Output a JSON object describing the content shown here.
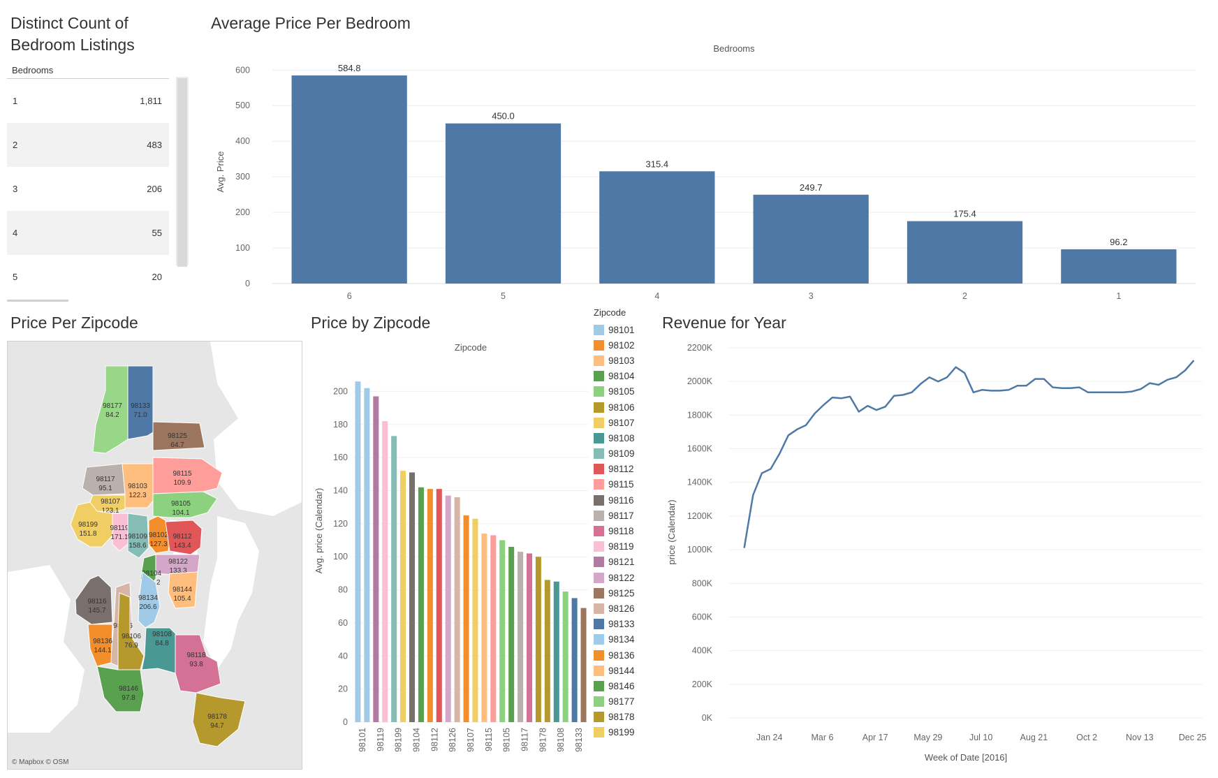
{
  "titles": {
    "distinct": "Distinct Count of Bedroom Listings",
    "avg_price": "Average Price Per Bedroom",
    "price_zip": "Price Per Zipcode",
    "price_by_zip": "Price by Zipcode",
    "revenue": "Revenue for Year"
  },
  "table": {
    "header": "Bedrooms",
    "rows": [
      {
        "bedrooms": "1",
        "count": "1,811"
      },
      {
        "bedrooms": "2",
        "count": "483"
      },
      {
        "bedrooms": "3",
        "count": "206"
      },
      {
        "bedrooms": "4",
        "count": "55"
      },
      {
        "bedrooms": "5",
        "count": "20"
      }
    ]
  },
  "map": {
    "attribution": "© Mapbox © OSM",
    "colors": {
      "water": "#ffffff",
      "land": "#e6e6e6"
    },
    "regions": [
      {
        "zip": "98177",
        "value": "84.2",
        "color": "#98d688"
      },
      {
        "zip": "98133",
        "value": "71.0",
        "color": "#4e79a7"
      },
      {
        "zip": "98125",
        "value": "64.7",
        "color": "#9c755f"
      },
      {
        "zip": "98117",
        "value": "95.1",
        "color": "#bab0ac"
      },
      {
        "zip": "98103",
        "value": "122.3",
        "color": "#ffbe7d"
      },
      {
        "zip": "98115",
        "value": "109.9",
        "color": "#ff9d9a"
      },
      {
        "zip": "98107",
        "value": "123.1",
        "color": "#f1ce63"
      },
      {
        "zip": "98105",
        "value": "104.1",
        "color": "#8cd17d"
      },
      {
        "zip": "98199",
        "value": "151.8",
        "color": "#f1ce63"
      },
      {
        "zip": "98119",
        "value": "171.1",
        "color": "#fabfd2"
      },
      {
        "zip": "98109",
        "value": "158.6",
        "color": "#86bcb6"
      },
      {
        "zip": "98102",
        "value": "127.3",
        "color": "#f28e2b"
      },
      {
        "zip": "98112",
        "value": "143.4",
        "color": "#e15759"
      },
      {
        "zip": "98122",
        "value": "133.3",
        "color": "#d4a6c8"
      },
      {
        "zip": "98104",
        "value": "136.2",
        "color": "#59a14f"
      },
      {
        "zip": "98144",
        "value": "105.4",
        "color": "#ffbe7d"
      },
      {
        "zip": "98116",
        "value": "145.7",
        "color": "#79706e"
      },
      {
        "zip": "98134",
        "value": "206.6",
        "color": "#a0cbe8"
      },
      {
        "zip": "98126",
        "value": "",
        "color": "#d7b5a6"
      },
      {
        "zip": "98136",
        "value": "144.1",
        "color": "#f28e2b"
      },
      {
        "zip": "98106",
        "value": "76.9",
        "color": "#b6992d"
      },
      {
        "zip": "98108",
        "value": "84.8",
        "color": "#499894"
      },
      {
        "zip": "98118",
        "value": "93.8",
        "color": "#d37295"
      },
      {
        "zip": "98146",
        "value": "97.8",
        "color": "#59a14f"
      },
      {
        "zip": "98178",
        "value": "94.7",
        "color": "#b6992d"
      }
    ]
  },
  "legend": {
    "title": "Zipcode",
    "items": [
      {
        "zip": "98101",
        "color": "#a0cbe8"
      },
      {
        "zip": "98102",
        "color": "#f28e2b"
      },
      {
        "zip": "98103",
        "color": "#ffbe7d"
      },
      {
        "zip": "98104",
        "color": "#59a14f"
      },
      {
        "zip": "98105",
        "color": "#8cd17d"
      },
      {
        "zip": "98106",
        "color": "#b6992d"
      },
      {
        "zip": "98107",
        "color": "#f1ce63"
      },
      {
        "zip": "98108",
        "color": "#499894"
      },
      {
        "zip": "98109",
        "color": "#86bcb6"
      },
      {
        "zip": "98112",
        "color": "#e15759"
      },
      {
        "zip": "98115",
        "color": "#ff9d9a"
      },
      {
        "zip": "98116",
        "color": "#79706e"
      },
      {
        "zip": "98117",
        "color": "#bab0ac"
      },
      {
        "zip": "98118",
        "color": "#d37295"
      },
      {
        "zip": "98119",
        "color": "#fabfd2"
      },
      {
        "zip": "98121",
        "color": "#b07aa1"
      },
      {
        "zip": "98122",
        "color": "#d4a6c8"
      },
      {
        "zip": "98125",
        "color": "#9d7660"
      },
      {
        "zip": "98126",
        "color": "#d7b5a6"
      },
      {
        "zip": "98133",
        "color": "#4e79a7"
      },
      {
        "zip": "98134",
        "color": "#a0cbe8"
      },
      {
        "zip": "98136",
        "color": "#f28e2b"
      },
      {
        "zip": "98144",
        "color": "#ffbe7d"
      },
      {
        "zip": "98146",
        "color": "#59a14f"
      },
      {
        "zip": "98177",
        "color": "#8cd17d"
      },
      {
        "zip": "98178",
        "color": "#b6992d"
      },
      {
        "zip": "98199",
        "color": "#f1ce63"
      }
    ]
  },
  "chart_data": [
    {
      "type": "bar",
      "title": "Average Price Per Bedroom",
      "column_header": "Bedrooms",
      "ylabel": "Avg. Price",
      "categories": [
        "6",
        "5",
        "4",
        "3",
        "2",
        "1"
      ],
      "values": [
        584.8,
        450.0,
        315.4,
        249.7,
        175.4,
        96.2
      ],
      "data_labels": [
        "584.8",
        "450.0",
        "315.4",
        "249.7",
        "175.4",
        "96.2"
      ],
      "yticks": [
        0,
        100,
        200,
        300,
        400,
        500,
        600
      ],
      "ylim": [
        0,
        630
      ],
      "color": "#4e79a7",
      "grid": true
    },
    {
      "type": "bar",
      "title": "Price by Zipcode",
      "column_header": "Zipcode",
      "ylabel": "Avg. price (Calendar)",
      "categories": [
        "98101",
        "98121",
        "98119",
        "98109",
        "98199",
        "98116",
        "98104",
        "98102",
        "98112",
        "98122",
        "98126",
        "98136",
        "98107",
        "98144",
        "98115",
        "98105",
        "98146",
        "98117",
        "98118",
        "98178",
        "98106",
        "98108",
        "98177",
        "98133",
        "98125"
      ],
      "x_tick_labels": [
        "98101",
        "98119",
        "98199",
        "98104",
        "98112",
        "98126",
        "98107",
        "98115",
        "98105",
        "98117",
        "98178",
        "98108",
        "98133"
      ],
      "values": [
        206,
        202,
        197,
        182,
        173,
        152,
        151,
        142,
        141,
        141,
        137,
        136,
        125,
        123,
        114,
        113,
        110,
        106,
        103,
        102,
        100,
        86,
        85,
        79,
        75,
        69
      ],
      "colors": [
        "#a0cbe8",
        "#a0cbe8",
        "#b07aa1",
        "#fabfd2",
        "#86bcb6",
        "#f1ce63",
        "#79706e",
        "#59a14f",
        "#f28e2b",
        "#e15759",
        "#d4a6c8",
        "#d7b5a6",
        "#f28e2b",
        "#f1ce63",
        "#ffbe7d",
        "#ff9d9a",
        "#8cd17d",
        "#59a14f",
        "#bab0ac",
        "#d37295",
        "#b6992d",
        "#b6992d",
        "#499894",
        "#8cd17d",
        "#4e79a7",
        "#9c755f"
      ],
      "yticks": [
        0,
        20,
        40,
        60,
        80,
        100,
        120,
        140,
        160,
        180,
        200
      ],
      "ylim": [
        0,
        212
      ],
      "grid": true
    },
    {
      "type": "line",
      "title": "Revenue for Year",
      "xlabel": "Week of Date [2016]",
      "ylabel": "price (Calendar)",
      "x": [
        "2016-01-04",
        "2016-01-11",
        "2016-01-18",
        "2016-01-25",
        "2016-02-01",
        "2016-02-08",
        "2016-02-15",
        "2016-02-22",
        "2016-02-29",
        "2016-03-07",
        "2016-03-14",
        "2016-03-21",
        "2016-03-28",
        "2016-04-04",
        "2016-04-11",
        "2016-04-18",
        "2016-04-25",
        "2016-05-02",
        "2016-05-09",
        "2016-05-16",
        "2016-05-23",
        "2016-05-30",
        "2016-06-06",
        "2016-06-13",
        "2016-06-20",
        "2016-06-27",
        "2016-07-04",
        "2016-07-11",
        "2016-07-18",
        "2016-07-25",
        "2016-08-01",
        "2016-08-08",
        "2016-08-15",
        "2016-08-22",
        "2016-08-29",
        "2016-09-05",
        "2016-09-12",
        "2016-09-19",
        "2016-09-26",
        "2016-10-03",
        "2016-10-10",
        "2016-10-17",
        "2016-10-24",
        "2016-10-31",
        "2016-11-07",
        "2016-11-14",
        "2016-11-21",
        "2016-11-28",
        "2016-12-05",
        "2016-12-12",
        "2016-12-19",
        "2016-12-26"
      ],
      "y": [
        1010000,
        1325000,
        1455000,
        1480000,
        1570000,
        1680000,
        1715000,
        1740000,
        1810000,
        1860000,
        1905000,
        1900000,
        1910000,
        1820000,
        1855000,
        1830000,
        1850000,
        1915000,
        1920000,
        1935000,
        1985000,
        2025000,
        2000000,
        2025000,
        2085000,
        2050000,
        1935000,
        1950000,
        1945000,
        1945000,
        1950000,
        1975000,
        1975000,
        2015000,
        2015000,
        1965000,
        1960000,
        1960000,
        1965000,
        1935000,
        1935000,
        1935000,
        1935000,
        1935000,
        1940000,
        1955000,
        1990000,
        1980000,
        2010000,
        2025000,
        2065000,
        2125000
      ],
      "xticks": [
        "Jan 24",
        "Mar 6",
        "Apr 17",
        "May 29",
        "Jul 10",
        "Aug 21",
        "Oct 2",
        "Nov 13",
        "Dec 25"
      ],
      "xtick_dates": [
        "2016-01-24",
        "2016-03-06",
        "2016-04-17",
        "2016-05-29",
        "2016-07-10",
        "2016-08-21",
        "2016-10-02",
        "2016-11-13",
        "2016-12-25"
      ],
      "yticks": [
        "0K",
        "200K",
        "400K",
        "600K",
        "800K",
        "1000K",
        "1200K",
        "1400K",
        "1600K",
        "1800K",
        "2000K",
        "2200K"
      ],
      "ylim": [
        0,
        2200000
      ],
      "color": "#4e79a7",
      "grid": true
    }
  ]
}
